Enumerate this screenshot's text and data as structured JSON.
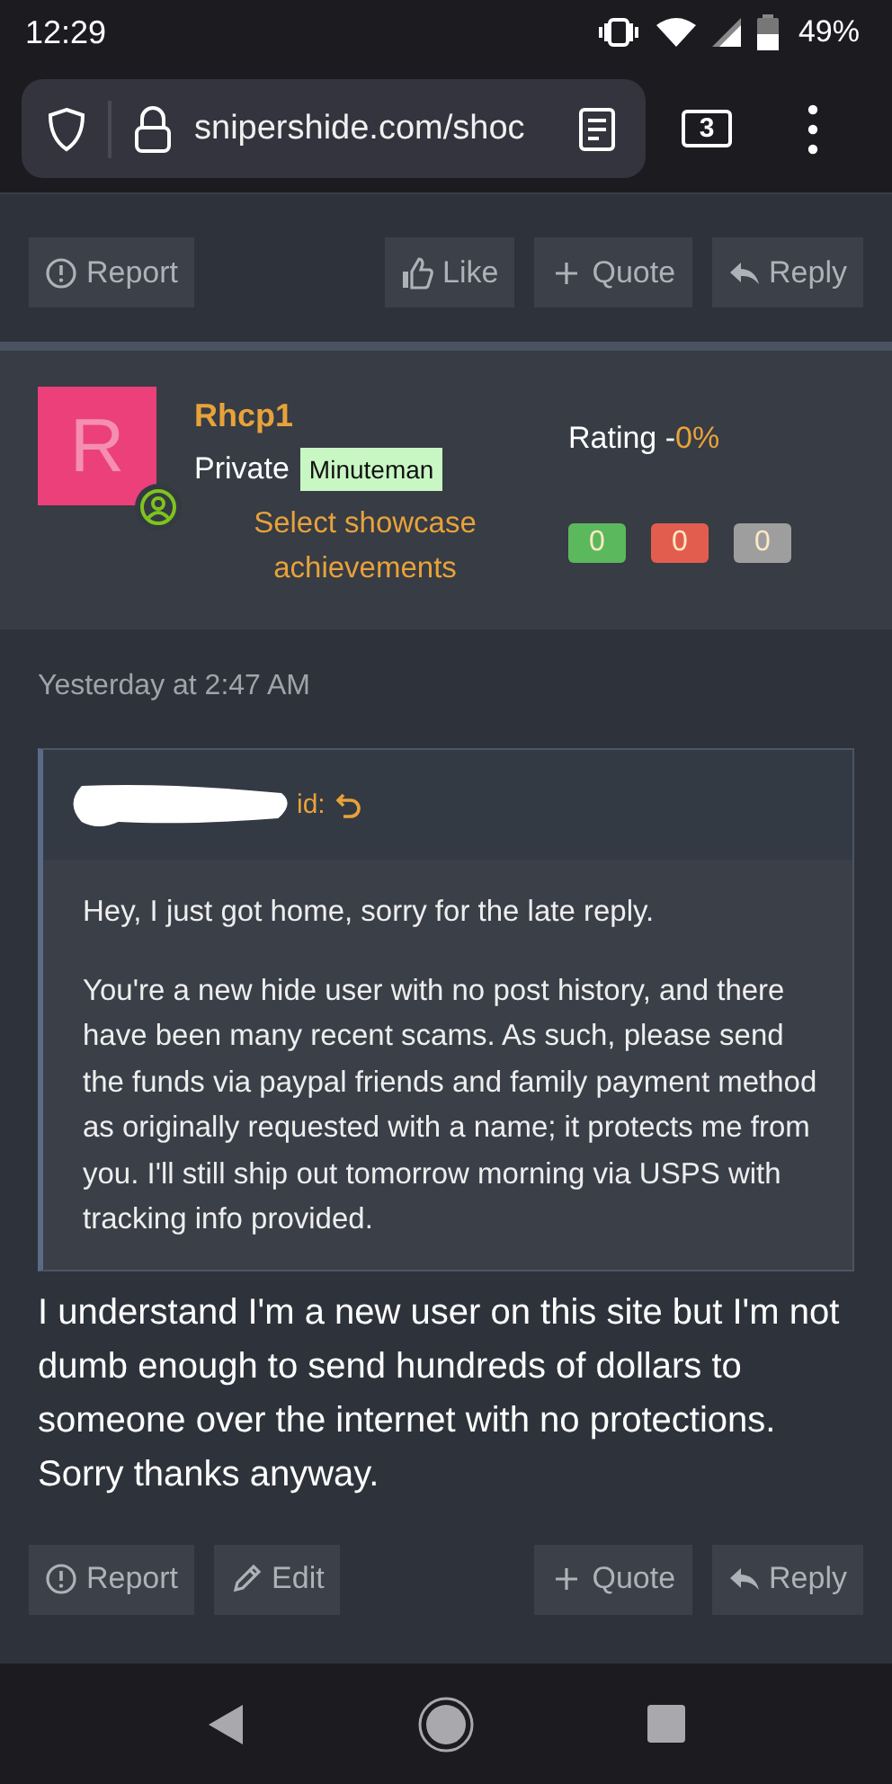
{
  "status_bar": {
    "time": "12:29",
    "battery": "49%"
  },
  "browser": {
    "url": "snipershide.com/shoc",
    "tab_count": "3"
  },
  "top_actions": [
    {
      "label": "Report",
      "kind": "report"
    },
    {
      "label": "Like",
      "kind": "like"
    },
    {
      "label": "Quote",
      "kind": "quote"
    },
    {
      "label": "Reply",
      "kind": "reply"
    }
  ],
  "user": {
    "avatar_letter": "R",
    "name": "Rhcp1",
    "rank": "Private",
    "badge": "Minuteman",
    "showcase_link": "Select showcase achievements",
    "rating_label": "Rating -",
    "rating_value": "0%",
    "counters": [
      {
        "value": "0",
        "color": "#5cb85c"
      },
      {
        "value": "0",
        "color": "#e35d4e"
      },
      {
        "value": "0",
        "color": "#9e9e9e"
      }
    ]
  },
  "post": {
    "timestamp": "Yesterday at 2:47 AM",
    "quote": {
      "author_visible": "id:",
      "paragraphs": [
        "Hey, I just got home, sorry for the late reply.",
        "You're a new hide user with no post history, and there have been many recent scams. As such, please send the funds via paypal friends and family payment method as originally requested with a name; it protects me from you. I'll still ship out tomorrow morning via USPS with tracking info provided."
      ]
    },
    "body": "I understand I'm a new user on this site but I'm not dumb enough to send hundreds of dollars to someone over the internet with no protections. Sorry thanks anyway.",
    "actions": [
      {
        "label": "Report",
        "kind": "report"
      },
      {
        "label": "Edit",
        "kind": "edit"
      },
      {
        "label": "Quote",
        "kind": "quote"
      },
      {
        "label": "Reply",
        "kind": "reply"
      }
    ]
  }
}
